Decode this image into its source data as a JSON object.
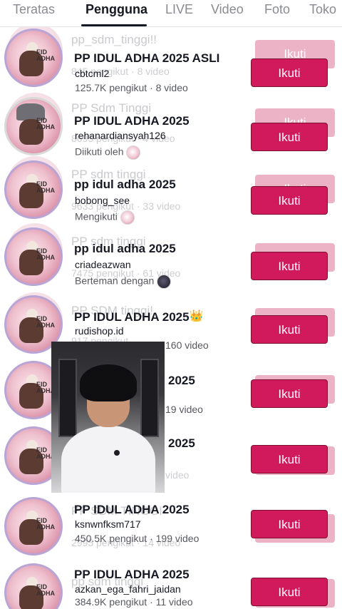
{
  "tabs": {
    "items": [
      {
        "label": "Teratas",
        "active": false
      },
      {
        "label": "Pengguna",
        "active": true
      },
      {
        "label": "LIVE",
        "active": false
      },
      {
        "label": "Video",
        "active": false
      },
      {
        "label": "Foto",
        "active": false
      },
      {
        "label": "Toko",
        "active": false
      }
    ]
  },
  "follow_label": "Ikuti",
  "users": [
    {
      "ghost_name": "pp_sdm_tinggi!!",
      "ghost_sub": "845 pengikut · 8 video",
      "name": "PP IDUL ADHA 2025 ASLI",
      "handle": "cbtcml2",
      "meta": "125.7K pengikut · 8 video"
    },
    {
      "ghost_name": "PP Sdm Tinggi",
      "ghost_sub": "8695 pengikut · 4 video",
      "name": "PP IDUL ADHA 2025",
      "handle": "rehanardiansyah126",
      "meta": "Diikuti oleh"
    },
    {
      "ghost_name": "PP sdm tinggi",
      "ghost_sub": "9633 pengikut · 33 video",
      "name": "pp idul adha 2025",
      "handle": "bobong_see",
      "meta": "Mengikuti"
    },
    {
      "ghost_name": "PP sdm tinggi",
      "ghost_sub": "7475 pengikut · 61 video",
      "name": "pp idul adha 2025",
      "handle": "criadeazwan",
      "meta": "Berteman dengan"
    },
    {
      "ghost_name": "PP SDM tinggi!",
      "ghost_sub": "917 pengikut",
      "name": "PP IDUL ADHA 2025",
      "handle": "rudishop.id",
      "meta": "160 video"
    },
    {
      "ghost_name": "",
      "ghost_sub": "",
      "name": "2025",
      "handle": "",
      "meta": "19 video"
    },
    {
      "ghost_name": "",
      "ghost_sub": "video",
      "name": "2025",
      "handle": "",
      "meta": ""
    },
    {
      "ghost_name": "PP SDM TINGGI",
      "ghost_sub": "2995 pengikut · 14 video",
      "name": "PP IDUL ADHA 2025",
      "handle": "ksnwnfksm717",
      "meta": "450.5K pengikut · 199 video"
    },
    {
      "ghost_name": "pp sdm tinggi",
      "ghost_sub": "",
      "name": "PP IDUL ADHA 2025",
      "handle": "azkan_ega_fahri_jaidan",
      "meta": "384.9K pengikut · 11 video"
    }
  ]
}
